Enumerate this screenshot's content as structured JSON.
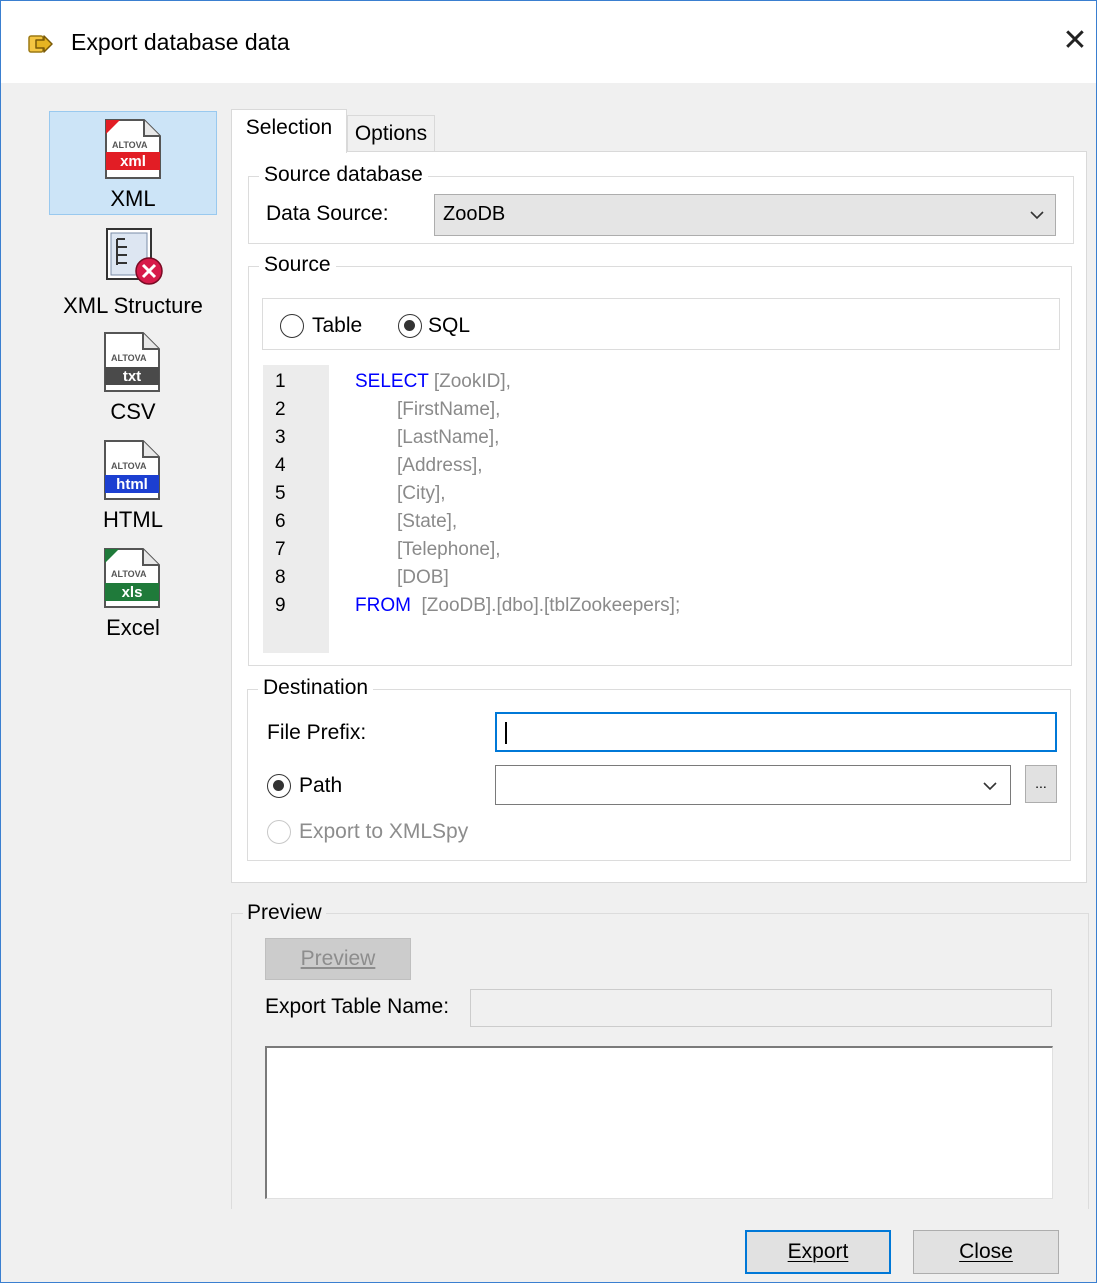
{
  "window": {
    "title": "Export database data",
    "close_glyph": "✕"
  },
  "formats": [
    {
      "label": "XML",
      "badge": "xml",
      "badge_color": "#e21d25",
      "icon": "xml-file-icon",
      "selected": true
    },
    {
      "label": "XML Structure",
      "icon": "xml-structure-icon",
      "selected": false
    },
    {
      "label": "CSV",
      "badge": "txt",
      "badge_color": "#4a4a4a",
      "icon": "csv-file-icon",
      "selected": false
    },
    {
      "label": "HTML",
      "badge": "html",
      "badge_color": "#1c3fd1",
      "icon": "html-file-icon",
      "selected": false
    },
    {
      "label": "Excel",
      "badge": "xls",
      "badge_color": "#1f7a3a",
      "icon": "excel-file-icon",
      "selected": false
    }
  ],
  "brand_text": "ALTOVA",
  "tabs": [
    {
      "label": "Selection",
      "active": true
    },
    {
      "label": "Options",
      "active": false
    }
  ],
  "source_database": {
    "group_title": "Source database",
    "data_source_label": "Data Source:",
    "data_source_value": "ZooDB"
  },
  "source": {
    "group_title": "Source",
    "table_label": "Table",
    "sql_label": "SQL",
    "selected_mode": "SQL",
    "sql_lines": [
      {
        "n": "1",
        "kw": "SELECT",
        "text": " [ZookID],"
      },
      {
        "n": "2",
        "kw": "",
        "text": "[FirstName],"
      },
      {
        "n": "3",
        "kw": "",
        "text": "[LastName],"
      },
      {
        "n": "4",
        "kw": "",
        "text": "[Address],"
      },
      {
        "n": "5",
        "kw": "",
        "text": "[City],"
      },
      {
        "n": "6",
        "kw": "",
        "text": "[State],"
      },
      {
        "n": "7",
        "kw": "",
        "text": "[Telephone],"
      },
      {
        "n": "8",
        "kw": "",
        "text": "[DOB]"
      },
      {
        "n": "9",
        "kw": "FROM",
        "text": "  [ZooDB].[dbo].[tblZookeepers];"
      }
    ]
  },
  "destination": {
    "group_title": "Destination",
    "file_prefix_label": "File Prefix:",
    "file_prefix_value": "",
    "path_label": "Path",
    "path_value": "",
    "browse_label": "...",
    "export_xmlspy_label": "Export to XMLSpy"
  },
  "preview": {
    "group_title": "Preview",
    "preview_button": "Preview",
    "export_table_name_label": "Export Table Name:",
    "export_table_name_value": ""
  },
  "footer": {
    "export_button": "Export",
    "close_button": "Close"
  }
}
